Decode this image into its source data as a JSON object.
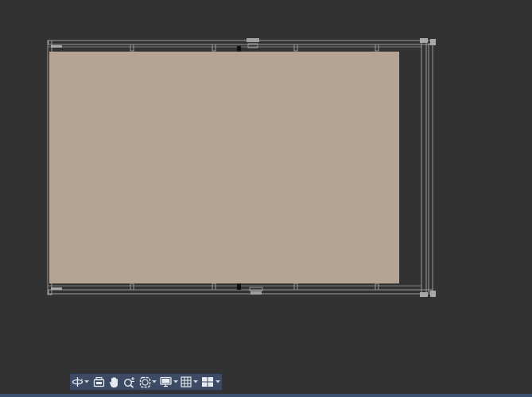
{
  "colors": {
    "background": "#323232",
    "sheet_fill": "#b9a897",
    "frame_stroke": "#9a9a9a",
    "navbar_bg": "#3c4a63",
    "icon_color": "#e6ebf2"
  },
  "navbar": {
    "items": [
      {
        "icon": "orbit-icon",
        "has_menu": true
      },
      {
        "icon": "steering-wheel-icon",
        "has_menu": false
      },
      {
        "icon": "pan-hand-icon",
        "has_menu": false
      },
      {
        "icon": "zoom-realtime-icon",
        "has_menu": false
      },
      {
        "icon": "zoom-extents-icon",
        "has_menu": true
      },
      {
        "icon": "display-monitor-icon",
        "has_menu": true
      },
      {
        "icon": "grid-icon",
        "has_menu": true
      },
      {
        "icon": "viewport-layout-icon",
        "has_menu": true
      }
    ]
  }
}
